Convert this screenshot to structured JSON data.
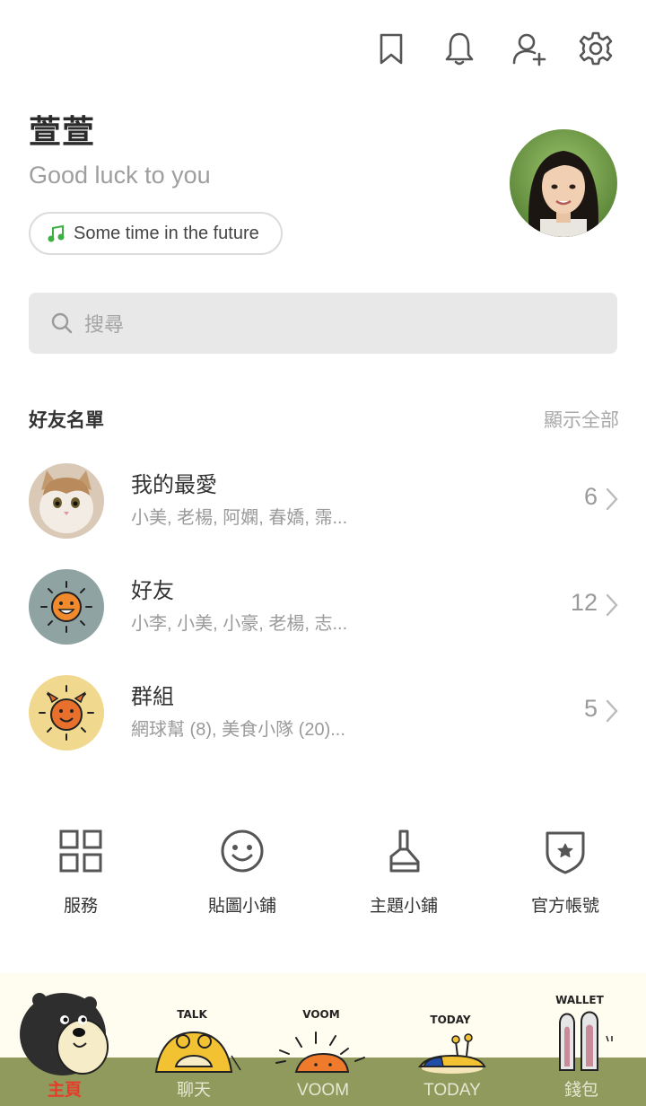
{
  "header": {
    "icons": [
      "bookmark-icon",
      "bell-icon",
      "add-friend-icon",
      "gear-icon"
    ]
  },
  "profile": {
    "name": "萱萱",
    "status": "Good luck to you",
    "music": "Some time in the future"
  },
  "search": {
    "placeholder": "搜尋"
  },
  "friends": {
    "title": "好友名單",
    "show_all": "顯示全部",
    "items": [
      {
        "title": "我的最愛",
        "subtitle": "小美, 老楊, 阿嫻, 春嬌, 霈...",
        "count": "6"
      },
      {
        "title": "好友",
        "subtitle": "小李, 小美, 小豪, 老楊, 志...",
        "count": "12"
      },
      {
        "title": "群組",
        "subtitle": "網球幫 (8), 美食小隊 (20)...",
        "count": "5"
      }
    ]
  },
  "services": [
    {
      "label": "服務",
      "icon": "grid-icon"
    },
    {
      "label": "貼圖小鋪",
      "icon": "smiley-icon"
    },
    {
      "label": "主題小鋪",
      "icon": "brush-icon"
    },
    {
      "label": "官方帳號",
      "icon": "shield-star-icon"
    }
  ],
  "bottom_nav": {
    "items": [
      {
        "label": "主頁",
        "active": true,
        "badge": ""
      },
      {
        "label": "聊天",
        "active": false,
        "badge": "TALK"
      },
      {
        "label": "VOOM",
        "active": false,
        "badge": "VOOM"
      },
      {
        "label": "TODAY",
        "active": false,
        "badge": "TODAY"
      },
      {
        "label": "錢包",
        "active": false,
        "badge": "WALLET"
      }
    ]
  },
  "colors": {
    "accent_active": "#e83b2a",
    "ground": "#8f9a5c",
    "search_bg": "#e8e8e8",
    "music_note": "#3cb043"
  }
}
